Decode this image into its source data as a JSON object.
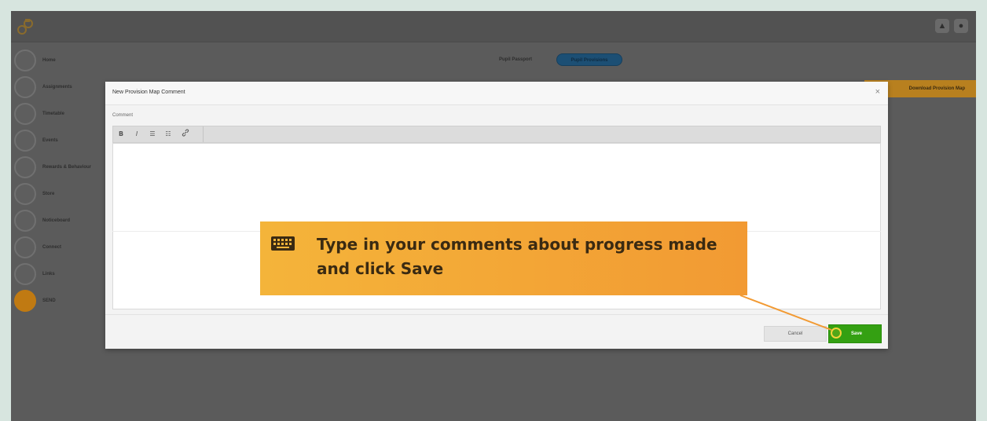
{
  "nav": {
    "items": [
      {
        "label": "Home",
        "active": false
      },
      {
        "label": "Assignments",
        "active": false
      },
      {
        "label": "Timetable",
        "active": false
      },
      {
        "label": "Events",
        "active": false
      },
      {
        "label": "Rewards & Behaviour",
        "active": false
      },
      {
        "label": "Store",
        "active": false
      },
      {
        "label": "Noticeboard",
        "active": false
      },
      {
        "label": "Connect",
        "active": false
      },
      {
        "label": "Links",
        "active": false
      },
      {
        "label": "SEND",
        "active": true
      }
    ]
  },
  "tabs": [
    {
      "label": "Pupil Passport",
      "active": false
    },
    {
      "label": "Pupil Provisions",
      "active": true
    }
  ],
  "action_button": "Download Provision Map",
  "modal": {
    "title": "New Provision Map Comment",
    "close_glyph": "×",
    "comment_label": "Comment",
    "toolbar": {
      "bold": "B",
      "italic": "I",
      "bullet_list": "☰",
      "numbered_list": "☷",
      "link": "🔗"
    },
    "comment_value": "",
    "cancel_label": "Cancel",
    "save_label": "Save"
  },
  "callout": {
    "text": "Type in your comments about progress made and click Save",
    "icon": "keyboard-icon"
  },
  "colors": {
    "accent_save": "#34a012",
    "callout": "#f4a83a",
    "active_tab": "#1c4f74",
    "active_nav": "#c07a12",
    "pointer": "#f6d23a"
  }
}
